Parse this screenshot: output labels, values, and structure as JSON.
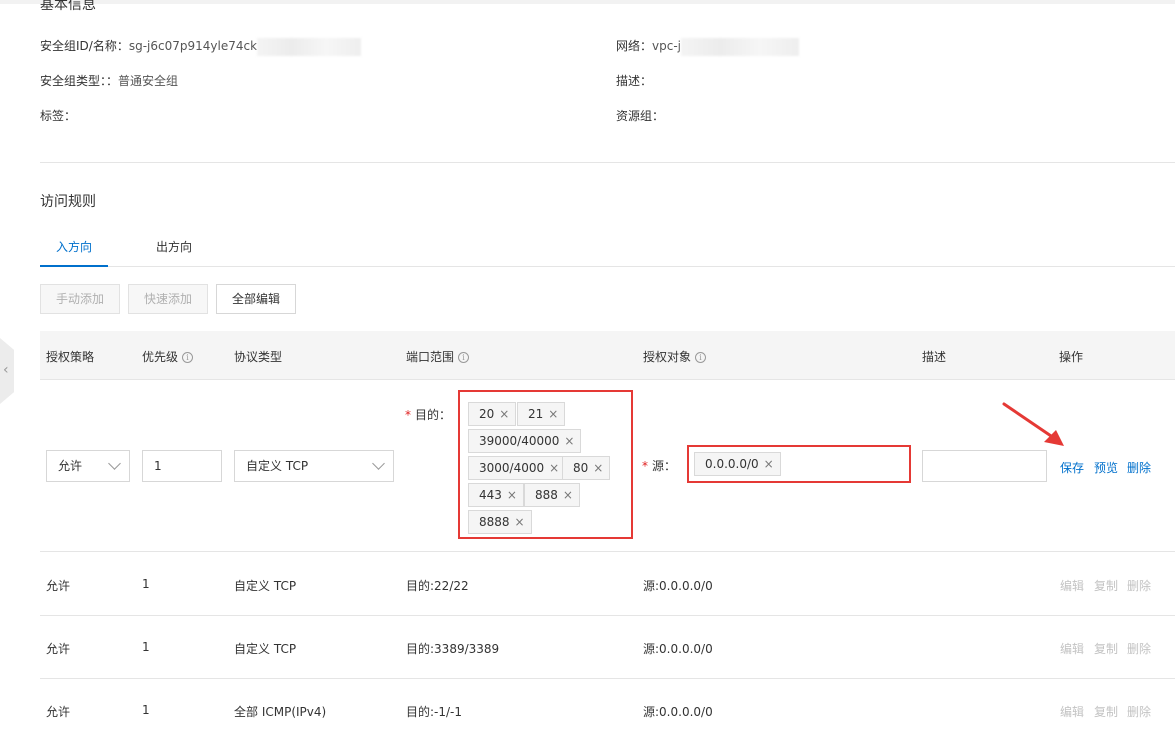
{
  "basic_info": {
    "title": "基本信息",
    "group_id_label": "安全组ID/名称：",
    "group_id_value": "sg-j6c07p914yle74ck",
    "network_label": "网络：",
    "network_value": "vpc-j",
    "type_label": "安全组类型：：",
    "type_value": "普通安全组",
    "desc_label": "描述：",
    "tags_label": "标签：",
    "resource_group_label": "资源组："
  },
  "access_rules": {
    "title": "访问规则",
    "tabs": [
      "入方向",
      "出方向"
    ],
    "buttons": {
      "manual_add": "手动添加",
      "quick_add": "快速添加",
      "edit_all": "全部编辑"
    }
  },
  "table": {
    "headers": {
      "policy": "授权策略",
      "priority": "优先级",
      "protocol": "协议类型",
      "port_range": "端口范围",
      "auth_object": "授权对象",
      "description": "描述",
      "action": "操作"
    },
    "edit_row": {
      "policy": "允许",
      "priority": "1",
      "protocol": "自定义 TCP",
      "dest_label": "目的：",
      "ports": [
        "20",
        "21",
        "39000/40000",
        "3000/4000",
        "80",
        "443",
        "888",
        "8888"
      ],
      "source_label": "源：",
      "sources": [
        "0.0.0.0/0"
      ],
      "description": "",
      "actions": {
        "save": "保存",
        "preview": "预览",
        "delete": "删除"
      }
    },
    "rows": [
      {
        "policy": "允许",
        "priority": "1",
        "protocol": "自定义 TCP",
        "port": "目的:22/22",
        "source": "源:0.0.0.0/0"
      },
      {
        "policy": "允许",
        "priority": "1",
        "protocol": "自定义 TCP",
        "port": "目的:3389/3389",
        "source": "源:0.0.0.0/0"
      },
      {
        "policy": "允许",
        "priority": "1",
        "protocol": "全部 ICMP(IPv4)",
        "port": "目的:-1/-1",
        "source": "源:0.0.0.0/0"
      }
    ],
    "row_actions": {
      "edit": "编辑",
      "copy": "复制",
      "delete": "删除"
    }
  },
  "colors": {
    "accent": "#0070cc",
    "highlight": "#e53935",
    "required": "#e02020"
  }
}
